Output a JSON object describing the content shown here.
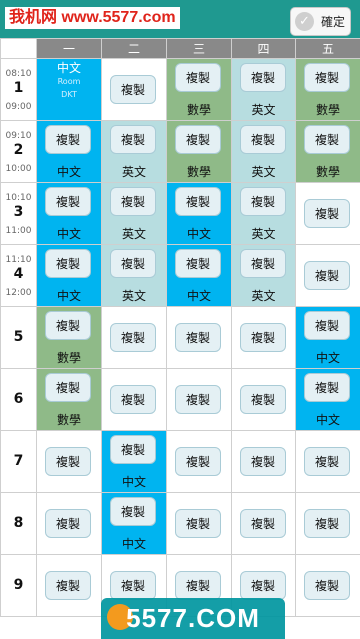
{
  "watermark": "我机网 www.5577.com",
  "header": {
    "confirm_label": "確定"
  },
  "days": [
    "一",
    "二",
    "三",
    "四",
    "五"
  ],
  "copy_label": "複製",
  "periods": [
    {
      "num": "1",
      "start": "08:10",
      "end": "09:00",
      "cells": [
        {
          "color": "blue",
          "subject": "中文",
          "room": "Room",
          "detail": "DKT"
        },
        {
          "color": "empty",
          "subject": ""
        },
        {
          "color": "green",
          "subject": "數學"
        },
        {
          "color": "teal",
          "subject": "英文"
        },
        {
          "color": "green",
          "subject": "數學"
        }
      ]
    },
    {
      "num": "2",
      "start": "09:10",
      "end": "10:00",
      "cells": [
        {
          "color": "blue",
          "subject": "中文"
        },
        {
          "color": "teal",
          "subject": "英文"
        },
        {
          "color": "green",
          "subject": "數學"
        },
        {
          "color": "teal",
          "subject": "英文"
        },
        {
          "color": "green",
          "subject": "數學"
        }
      ]
    },
    {
      "num": "3",
      "start": "10:10",
      "end": "11:00",
      "cells": [
        {
          "color": "blue",
          "subject": "中文"
        },
        {
          "color": "teal",
          "subject": "英文"
        },
        {
          "color": "blue",
          "subject": "中文"
        },
        {
          "color": "teal",
          "subject": "英文"
        },
        {
          "color": "empty",
          "subject": ""
        }
      ]
    },
    {
      "num": "4",
      "start": "11:10",
      "end": "12:00",
      "cells": [
        {
          "color": "blue",
          "subject": "中文"
        },
        {
          "color": "teal",
          "subject": "英文"
        },
        {
          "color": "blue",
          "subject": "中文"
        },
        {
          "color": "teal",
          "subject": "英文"
        },
        {
          "color": "empty",
          "subject": ""
        }
      ]
    },
    {
      "num": "5",
      "start": "",
      "end": "",
      "cells": [
        {
          "color": "green",
          "subject": "數學"
        },
        {
          "color": "empty",
          "subject": ""
        },
        {
          "color": "empty",
          "subject": ""
        },
        {
          "color": "empty",
          "subject": ""
        },
        {
          "color": "blue",
          "subject": "中文"
        }
      ]
    },
    {
      "num": "6",
      "start": "",
      "end": "",
      "cells": [
        {
          "color": "green",
          "subject": "數學"
        },
        {
          "color": "empty",
          "subject": ""
        },
        {
          "color": "empty",
          "subject": ""
        },
        {
          "color": "empty",
          "subject": ""
        },
        {
          "color": "blue",
          "subject": "中文"
        }
      ]
    },
    {
      "num": "7",
      "start": "",
      "end": "",
      "cells": [
        {
          "color": "empty",
          "subject": ""
        },
        {
          "color": "blue",
          "subject": "中文"
        },
        {
          "color": "empty",
          "subject": ""
        },
        {
          "color": "empty",
          "subject": ""
        },
        {
          "color": "empty",
          "subject": ""
        }
      ]
    },
    {
      "num": "8",
      "start": "",
      "end": "",
      "cells": [
        {
          "color": "empty",
          "subject": ""
        },
        {
          "color": "blue",
          "subject": "中文"
        },
        {
          "color": "empty",
          "subject": ""
        },
        {
          "color": "empty",
          "subject": ""
        },
        {
          "color": "empty",
          "subject": ""
        }
      ]
    },
    {
      "num": "9",
      "start": "",
      "end": "",
      "cells": [
        {
          "color": "empty",
          "subject": ""
        },
        {
          "color": "empty",
          "subject": ""
        },
        {
          "color": "empty",
          "subject": ""
        },
        {
          "color": "empty",
          "subject": ""
        },
        {
          "color": "empty",
          "subject": ""
        }
      ]
    }
  ],
  "colors": {
    "blue": "#00b4f0",
    "teal": "#b7dde0",
    "green": "#8fba88",
    "header": "#1f9990"
  },
  "footer_logo": "5577.COM"
}
